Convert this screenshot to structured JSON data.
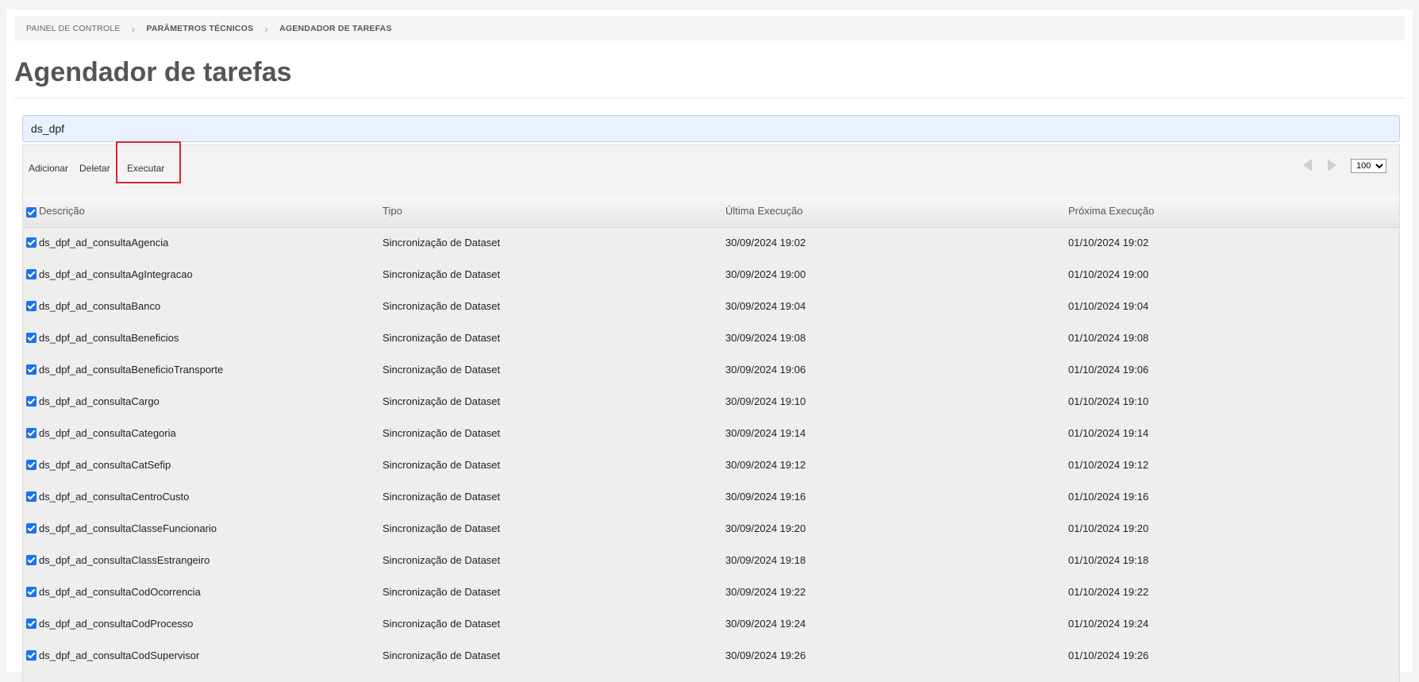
{
  "breadcrumb": {
    "items": [
      "PAINEL DE CONTROLE",
      "PARÂMETROS TÉCNICOS",
      "AGENDADOR DE TAREFAS"
    ]
  },
  "page": {
    "title": "Agendador de tarefas"
  },
  "search": {
    "value": "ds_dpf"
  },
  "toolbar": {
    "add_label": "Adicionar",
    "delete_label": "Deletar",
    "execute_label": "Executar",
    "page_size": "100",
    "highlight_color": "#e0232b"
  },
  "table": {
    "columns": [
      "Descrição",
      "Tipo",
      "Última Execução",
      "Próxima Execução"
    ],
    "rows": [
      {
        "descricao": "ds_dpf_ad_consultaAgencia",
        "tipo": "Sincronização de Dataset",
        "ultima": "30/09/2024 19:02",
        "proxima": "01/10/2024 19:02"
      },
      {
        "descricao": "ds_dpf_ad_consultaAgIntegracao",
        "tipo": "Sincronização de Dataset",
        "ultima": "30/09/2024 19:00",
        "proxima": "01/10/2024 19:00"
      },
      {
        "descricao": "ds_dpf_ad_consultaBanco",
        "tipo": "Sincronização de Dataset",
        "ultima": "30/09/2024 19:04",
        "proxima": "01/10/2024 19:04"
      },
      {
        "descricao": "ds_dpf_ad_consultaBeneficios",
        "tipo": "Sincronização de Dataset",
        "ultima": "30/09/2024 19:08",
        "proxima": "01/10/2024 19:08"
      },
      {
        "descricao": "ds_dpf_ad_consultaBeneficioTransporte",
        "tipo": "Sincronização de Dataset",
        "ultima": "30/09/2024 19:06",
        "proxima": "01/10/2024 19:06"
      },
      {
        "descricao": "ds_dpf_ad_consultaCargo",
        "tipo": "Sincronização de Dataset",
        "ultima": "30/09/2024 19:10",
        "proxima": "01/10/2024 19:10"
      },
      {
        "descricao": "ds_dpf_ad_consultaCategoria",
        "tipo": "Sincronização de Dataset",
        "ultima": "30/09/2024 19:14",
        "proxima": "01/10/2024 19:14"
      },
      {
        "descricao": "ds_dpf_ad_consultaCatSefip",
        "tipo": "Sincronização de Dataset",
        "ultima": "30/09/2024 19:12",
        "proxima": "01/10/2024 19:12"
      },
      {
        "descricao": "ds_dpf_ad_consultaCentroCusto",
        "tipo": "Sincronização de Dataset",
        "ultima": "30/09/2024 19:16",
        "proxima": "01/10/2024 19:16"
      },
      {
        "descricao": "ds_dpf_ad_consultaClasseFuncionario",
        "tipo": "Sincronização de Dataset",
        "ultima": "30/09/2024 19:20",
        "proxima": "01/10/2024 19:20"
      },
      {
        "descricao": "ds_dpf_ad_consultaClassEstrangeiro",
        "tipo": "Sincronização de Dataset",
        "ultima": "30/09/2024 19:18",
        "proxima": "01/10/2024 19:18"
      },
      {
        "descricao": "ds_dpf_ad_consultaCodOcorrencia",
        "tipo": "Sincronização de Dataset",
        "ultima": "30/09/2024 19:22",
        "proxima": "01/10/2024 19:22"
      },
      {
        "descricao": "ds_dpf_ad_consultaCodProcesso",
        "tipo": "Sincronização de Dataset",
        "ultima": "30/09/2024 19:24",
        "proxima": "01/10/2024 19:24"
      },
      {
        "descricao": "ds_dpf_ad_consultaCodSupervisor",
        "tipo": "Sincronização de Dataset",
        "ultima": "30/09/2024 19:26",
        "proxima": "01/10/2024 19:26"
      }
    ]
  }
}
